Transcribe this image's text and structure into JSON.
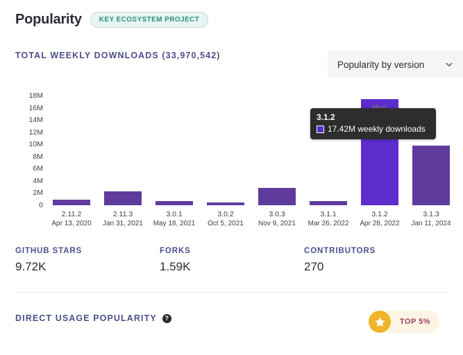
{
  "header": {
    "title": "Popularity",
    "badge": "KEY ECOSYSTEM PROJECT"
  },
  "section": {
    "downloads_label": "TOTAL WEEKLY DOWNLOADS (33,970,542)"
  },
  "dropdown": {
    "selected": "Popularity by version",
    "icon": "chevron-down-icon"
  },
  "tooltip": {
    "version": "3.1.2",
    "value_text": "17.42M weekly downloads",
    "swatch_color": "#5c2ccc"
  },
  "most_popular_label": "Most Popular",
  "stats": [
    {
      "label": "GITHUB STARS",
      "value": "9.72K"
    },
    {
      "label": "FORKS",
      "value": "1.59K"
    },
    {
      "label": "CONTRIBUTORS",
      "value": "270"
    }
  ],
  "bottom": {
    "label": "DIRECT USAGE POPULARITY",
    "help_icon": "help-circle-icon",
    "badge_text": "TOP 5%",
    "badge_icon": "star-icon"
  },
  "colors": {
    "bar": "#5f3b9e",
    "bar_highlight": "#5c2ccc",
    "accent_label": "#4b4f8a",
    "badge_teal": "#2b8e82",
    "badge_gold": "#f0b429",
    "badge_text": "#9b3c5e"
  },
  "chart_data": {
    "type": "bar",
    "title": "TOTAL WEEKLY DOWNLOADS (33,970,542)",
    "xlabel": "",
    "ylabel": "",
    "ylim": [
      0,
      18000000
    ],
    "grid": false,
    "legend": "none",
    "ytick_labels": [
      "18M",
      "16M",
      "14M",
      "12M",
      "10M",
      "8M",
      "6M",
      "4M",
      "2M",
      "0"
    ],
    "ytick_values": [
      18000000,
      16000000,
      14000000,
      12000000,
      10000000,
      8000000,
      6000000,
      4000000,
      2000000,
      0
    ],
    "categories": [
      "2.11.2",
      "2.11.3",
      "3.0.1",
      "3.0.2",
      "3.0.3",
      "3.1.1",
      "3.1.2",
      "3.1.3"
    ],
    "category_dates": [
      "Apr 13, 2020",
      "Jan 31, 2021",
      "May 18, 2021",
      "Oct 5, 2021",
      "Nov 9, 2021",
      "Mar 26, 2022",
      "Apr 28, 2022",
      "Jan 11, 2024"
    ],
    "values": [
      900000,
      2300000,
      700000,
      400000,
      2800000,
      700000,
      17420000,
      9800000
    ],
    "value_labels": [
      "0.9M",
      "2.3M",
      "0.7M",
      "0.4M",
      "2.8M",
      "0.7M",
      "17.42M",
      "9.8M"
    ],
    "highlight_index": 6,
    "series": [
      {
        "name": "weekly downloads",
        "values": [
          900000,
          2300000,
          700000,
          400000,
          2800000,
          700000,
          17420000,
          9800000
        ]
      }
    ]
  }
}
